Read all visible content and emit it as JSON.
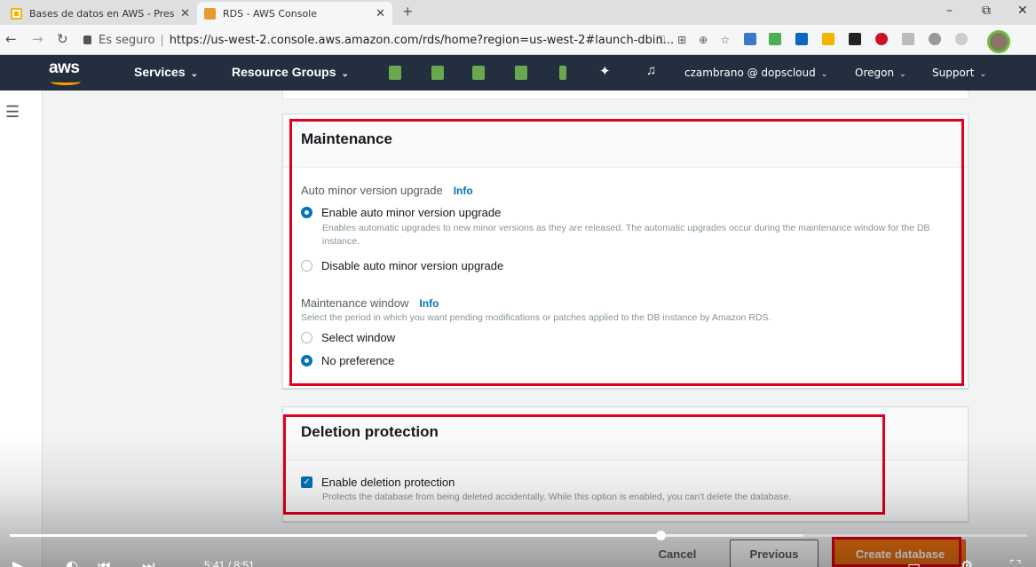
{
  "browser": {
    "tabs": [
      {
        "title": "Bases de datos en AWS - Present",
        "active": false
      },
      {
        "title": "RDS - AWS Console",
        "active": true
      }
    ],
    "window_controls": {
      "minimize": "–",
      "restore": "⧉",
      "close": "✕"
    },
    "address": {
      "secure_label": "Es seguro",
      "url": "https://us-west-2.console.aws.amazon.com/rds/home?region=us-west-2#launch-dbin..."
    }
  },
  "aws_nav": {
    "logo": "aws",
    "services": "Services",
    "resource_groups": "Resource Groups",
    "account": "czambrano @ dopscloud",
    "region": "Oregon",
    "support": "Support",
    "caret": "⌄"
  },
  "maintenance": {
    "title": "Maintenance",
    "auto_minor_label": "Auto minor version upgrade",
    "info": "Info",
    "enable_option": "Enable auto minor version upgrade",
    "enable_hint": "Enables automatic upgrades to new minor versions as they are released. The automatic upgrades occur during the maintenance window for the DB instance.",
    "disable_option": "Disable auto minor version upgrade",
    "window_label": "Maintenance window",
    "window_hint": "Select the period in which you want pending modifications or patches applied to the DB instance by Amazon RDS.",
    "select_window": "Select window",
    "no_preference": "No preference",
    "auto_minor_selected": "Enable auto minor version upgrade",
    "window_selected": "No preference"
  },
  "deletion": {
    "title": "Deletion protection",
    "option": "Enable deletion protection",
    "hint": "Protects the database from being deleted accidentally. While this option is enabled, you can't delete the database.",
    "checked": true
  },
  "footer": {
    "cancel": "Cancel",
    "previous": "Previous",
    "create": "Create database"
  },
  "video": {
    "progress": 0.64,
    "buffered": 0.78,
    "time": "5:41 / 8:51"
  },
  "colors": {
    "aws_nav": "#232f3e",
    "aws_orange": "#ec7211",
    "link_blue": "#0073bb",
    "highlight_red": "#e0001b"
  }
}
